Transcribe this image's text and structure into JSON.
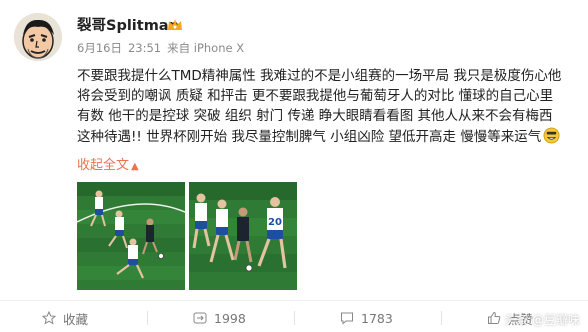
{
  "user": {
    "name": "裂哥Splitman",
    "vip_badge_icon": "vip-crown-icon"
  },
  "meta": {
    "date": "6月16日",
    "time": "23:51",
    "source": "来自 iPhone X"
  },
  "post": {
    "lines": [
      "不要跟我提什么TMD精神属性 我难过的不是小组赛的一场平局 我只是极度伤心他",
      "将会受到的嘲讽 质疑 和抨击 更不要跟我提他与葡萄牙人的对比 懂球的自己心里",
      "有数 他干的是控球 突破 组织 射门 传递 睁大眼睛看看图 其他人从来不会有梅西",
      "这种待遇!! 世界杯刚开始 我尽量控制脾气 小组凶险 望低开高走 慢慢等来运气"
    ],
    "trailing_emoji": "grin-emoji-icon",
    "collapse_label": "收起全文",
    "collapse_icon": "chevron-up-icon"
  },
  "photos": [
    {
      "name": "football-photo-1",
      "jersey_number": ""
    },
    {
      "name": "football-photo-2",
      "jersey_number": "20"
    }
  ],
  "actions": {
    "favorite_label": "收藏",
    "repost_count": "1998",
    "comment_count": "1783",
    "like_label": "点赞"
  },
  "watermark": "头条 @豆瓣味",
  "colors": {
    "accent": "#eb7350",
    "pitch_green": "#2f7a34",
    "iceland_shirt": "#ffffff",
    "iceland_blue": "#1d4fa0",
    "argentina_dark": "#1c2430"
  }
}
